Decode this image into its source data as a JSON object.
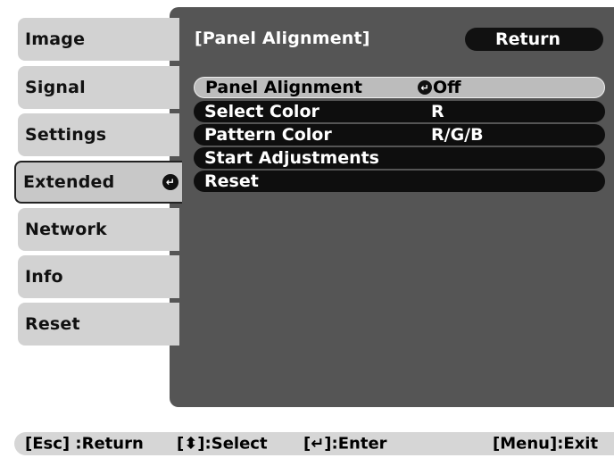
{
  "sidebar": {
    "items": [
      {
        "label": "Image"
      },
      {
        "label": "Signal"
      },
      {
        "label": "Settings"
      },
      {
        "label": "Extended",
        "selected": true,
        "icon": "enter-icon"
      },
      {
        "label": "Network"
      },
      {
        "label": "Info"
      },
      {
        "label": "Reset"
      }
    ]
  },
  "header": {
    "title": "[Panel Alignment]",
    "return_label": "Return"
  },
  "menu": {
    "rows": [
      {
        "label": "Panel Alignment",
        "value": "Off",
        "value_icon": "enter-icon",
        "selected": true
      },
      {
        "label": "Select Color",
        "value": "R"
      },
      {
        "label": "Pattern Color",
        "value": "R/G/B"
      },
      {
        "label": "Start Adjustments",
        "value": ""
      },
      {
        "label": "Reset",
        "value": ""
      }
    ]
  },
  "helpbar": {
    "esc": "[Esc] :Return",
    "select": "[⬍]:Select",
    "enter": "[↵]:Enter",
    "menu": "[Menu]:Exit"
  },
  "colors": {
    "panel": "#555555",
    "tab": "#d2d2d2",
    "row": "#0e0e0e",
    "row_selected": "#bcbcbc"
  }
}
